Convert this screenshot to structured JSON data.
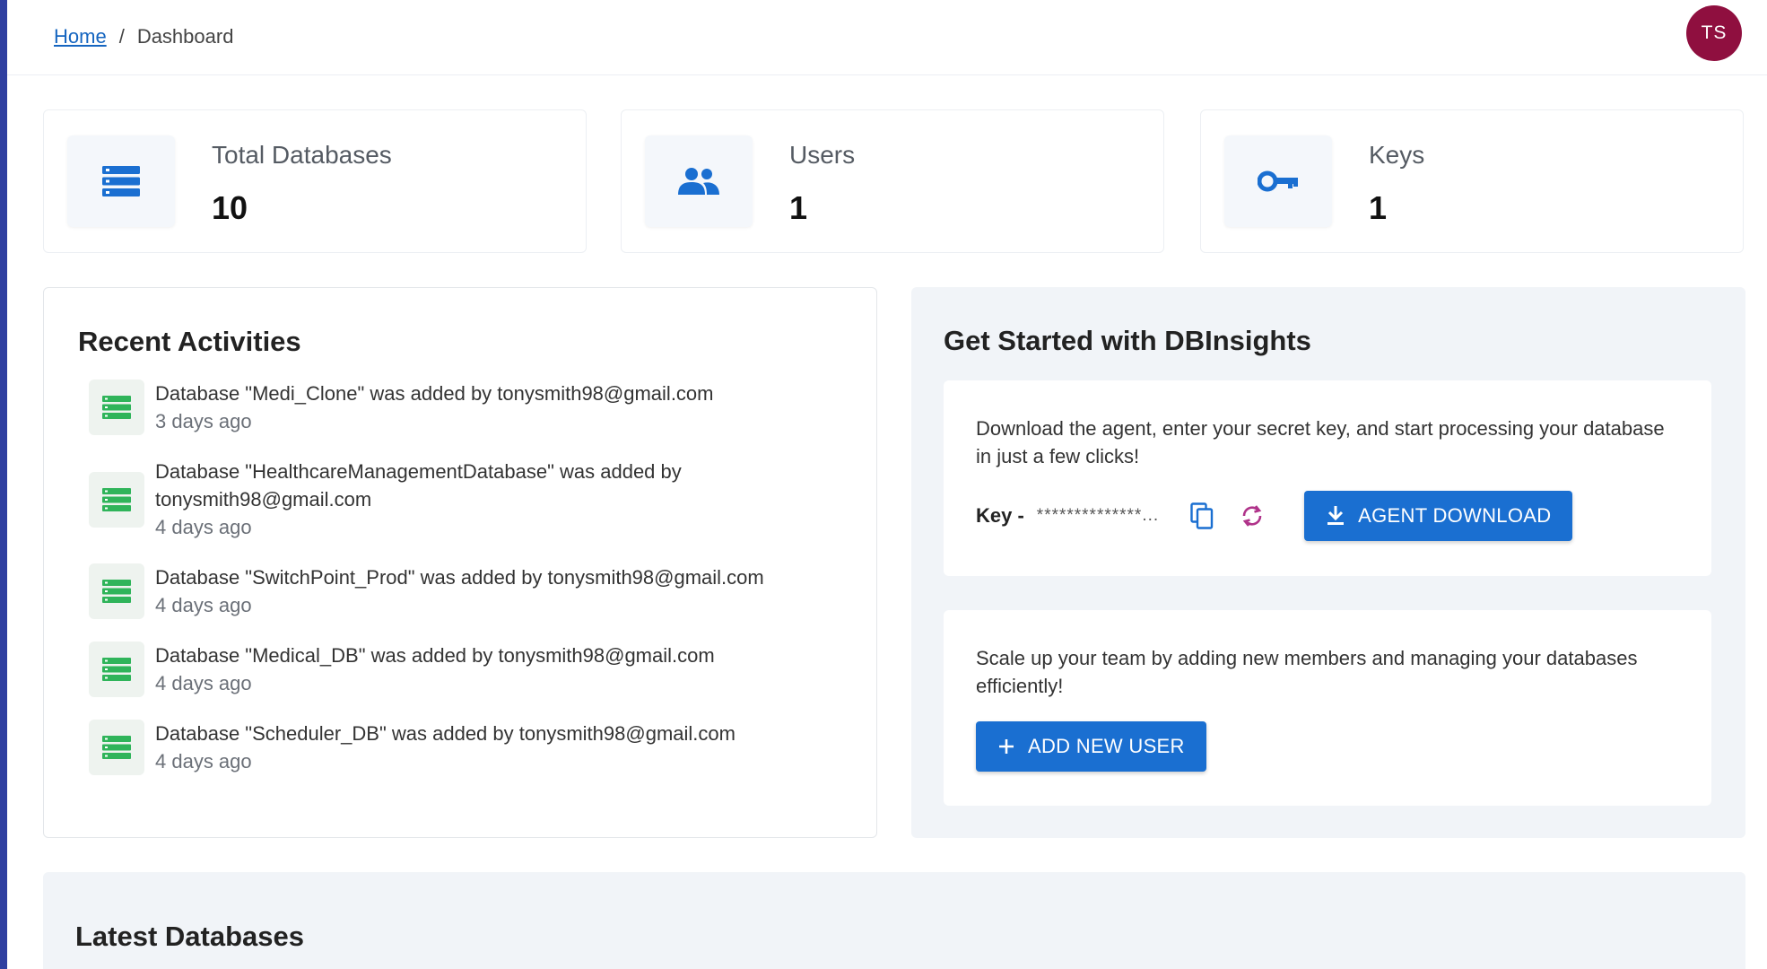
{
  "header": {
    "breadcrumb": {
      "home": "Home",
      "separator": "/",
      "current": "Dashboard"
    },
    "avatar_initials": "TS"
  },
  "stats": [
    {
      "label": "Total Databases",
      "value": "10",
      "icon": "database-icon"
    },
    {
      "label": "Users",
      "value": "1",
      "icon": "users-icon"
    },
    {
      "label": "Keys",
      "value": "1",
      "icon": "key-icon"
    }
  ],
  "recent": {
    "title": "Recent Activities",
    "items": [
      {
        "text": "Database \"Medi_Clone\" was added by tonysmith98@gmail.com",
        "time": "3 days ago"
      },
      {
        "text": "Database \"HealthcareManagementDatabase\" was added by tonysmith98@gmail.com",
        "time": "4 days ago"
      },
      {
        "text": "Database \"SwitchPoint_Prod\" was added by tonysmith98@gmail.com",
        "time": "4 days ago"
      },
      {
        "text": "Database \"Medical_DB\" was added by tonysmith98@gmail.com",
        "time": "4 days ago"
      },
      {
        "text": "Database \"Scheduler_DB\" was added by tonysmith98@gmail.com",
        "time": "4 days ago"
      }
    ]
  },
  "get_started": {
    "title": "Get Started with DBInsights",
    "agent": {
      "description": "Download the agent, enter your secret key, and start processing your database in just a few clicks!",
      "key_label": "Key -",
      "key_value": "**************...",
      "download_label": "AGENT DOWNLOAD"
    },
    "team": {
      "description": "Scale up your team by adding new members and managing your databases efficiently!",
      "add_user_label": "ADD NEW USER"
    }
  },
  "latest": {
    "title": "Latest Databases"
  },
  "colors": {
    "accent": "#1a6fd1",
    "avatar": "#8f0f3f",
    "activity_icon": "#2fb45a",
    "refresh_icon": "#b0338a"
  }
}
